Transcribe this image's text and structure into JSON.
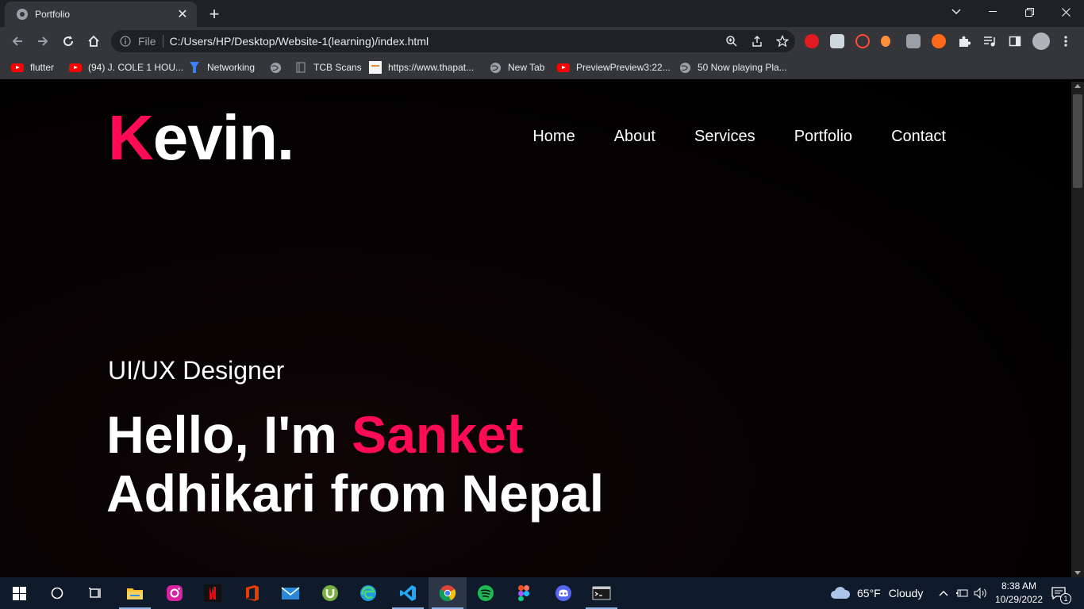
{
  "browser": {
    "tab_title": "Portfolio",
    "address_scheme": "File",
    "address_url": "C:/Users/HP/Desktop/Website-1(learning)/index.html"
  },
  "bookmarks": [
    {
      "label": "flutter",
      "icon": "youtube-icon"
    },
    {
      "label": "(94) J. COLE 1 HOU...",
      "icon": "youtube-icon"
    },
    {
      "label": "Networking",
      "icon": "figure-icon"
    },
    {
      "label": "",
      "icon": "globe-icon"
    },
    {
      "label": "TCB Scans",
      "icon": "page-icon"
    },
    {
      "label": "https://www.thapat...",
      "icon": "page-icon"
    },
    {
      "label": "New Tab",
      "icon": "globe-icon"
    },
    {
      "label": "PreviewPreview3:22...",
      "icon": "youtube-icon"
    },
    {
      "label": "50 Now playing Pla...",
      "icon": "globe-icon"
    }
  ],
  "site": {
    "logo_first": "K",
    "logo_rest": "evin.",
    "nav": [
      "Home",
      "About",
      "Services",
      "Portfolio",
      "Contact"
    ],
    "subtitle": "UI/UX Designer",
    "headline_prefix": "Hello, I'm ",
    "headline_accent": "Sanket",
    "headline_line2": "Adhikari from Nepal",
    "accent_color": "#ff0a54"
  },
  "taskbar": {
    "weather_temp": "65°F",
    "weather_condition": "Cloudy",
    "time": "8:38 AM",
    "date": "10/29/2022",
    "notification_count": "1"
  }
}
